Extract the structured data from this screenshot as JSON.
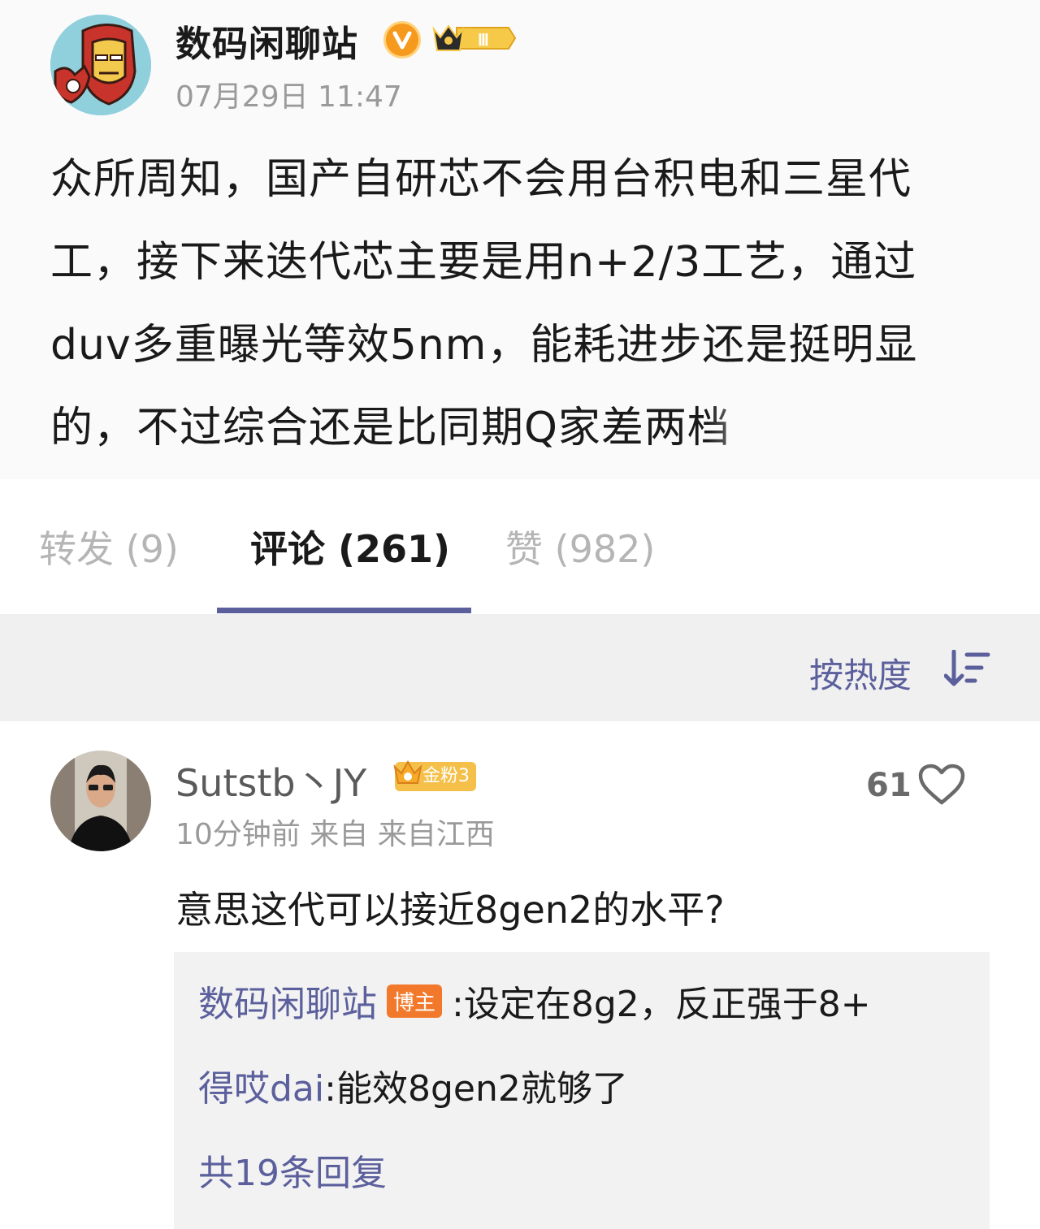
{
  "post": {
    "author": "数码闲聊站",
    "verified_icon": "verified-v-icon",
    "vip_level": "Ⅲ",
    "time": "07月29日 11:47",
    "body": "众所周知，国产自研芯不会用台积电和三星代\n工，接下来迭代芯主要是用n+2/3工艺，通过\nduv多重曝光等效5nm，能耗进步还是挺明显\n的，不过综合还是比同期Q家差两档"
  },
  "tabs": [
    {
      "label": "转发 (9)"
    },
    {
      "label": "评论 (261)"
    },
    {
      "label": "赞 (982)"
    }
  ],
  "sort": {
    "label": "按热度",
    "icon": "sort-icon"
  },
  "comment": {
    "user": "Sutstb丶JY",
    "fan_badge": "金粉3",
    "meta": "10分钟前 来自 来自江西",
    "likes": "61",
    "text": "意思这代可以接近8gen2的水平?",
    "replies": [
      {
        "name": "数码闲聊站",
        "tag": "博主",
        "text": ":设定在8g2，反正强于8+"
      },
      {
        "name": "得哎dai",
        "text": ":能效8gen2就够了"
      }
    ],
    "reply_count": "共19条回复"
  },
  "colors": {
    "accent": "#5b5f9c",
    "owner_tag": "#f2792b",
    "verified": "#f59a1c",
    "fan_badge": "#f5c04a"
  }
}
